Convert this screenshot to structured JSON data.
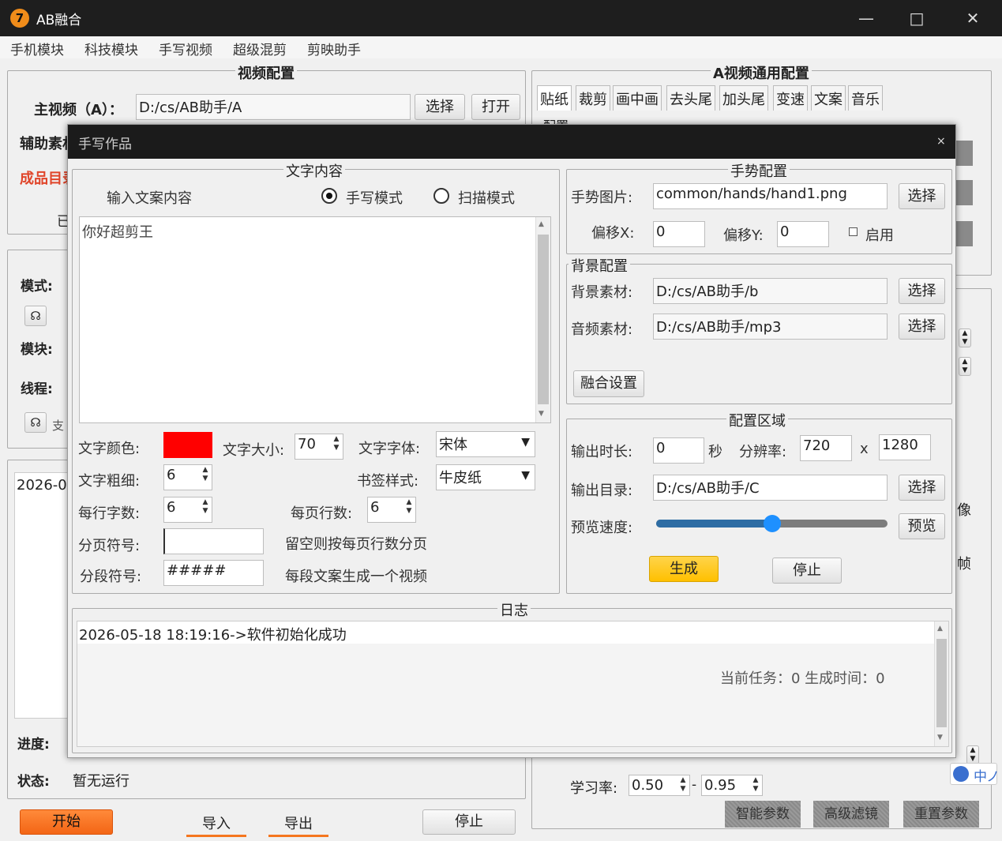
{
  "window": {
    "title": "AB融合",
    "app_icon_text": "7"
  },
  "menu": [
    "手机模块",
    "科技模块",
    "手写视频",
    "超级混剪",
    "剪映助手"
  ],
  "video_config": {
    "title": "视频配置",
    "main_video_label": "主视频（A）：",
    "main_video_path": "D:/cs/AB助手/A",
    "select_label": "选择",
    "open_label": "打开",
    "aux_label": "辅助素材",
    "output_label": "成品目录",
    "partial_text": "已"
  },
  "left_panel": {
    "mode_label": "模式:",
    "module_label": "模块:",
    "thread_label": "线程:",
    "partial_support": "支",
    "log_partial": "2026-05",
    "progress_label": "进度:",
    "status_label": "状态:",
    "status_value": "暂无运行",
    "start_label": "开始",
    "import_label": "导入",
    "export_label": "导出",
    "stop_label": "停止"
  },
  "a_config": {
    "title": "A视频通用配置",
    "tabs": [
      "贴纸",
      "裁剪",
      "画中画",
      "去头尾",
      "加头尾",
      "变速",
      "文案",
      "音乐"
    ],
    "partial_config": "配置",
    "partial_image": "像",
    "partial_frame": "帧",
    "lr_label": "学习率:",
    "lr_value1": "0.50",
    "lr_value2": "0.95",
    "lr_dash": "-",
    "btn_smart": "智能参数",
    "btn_advanced": "高级滤镜",
    "btn_reset": "重置参数",
    "partial_cn": "中",
    "partial_cn2": "ノ"
  },
  "dialog": {
    "title": "手写作品",
    "close": "×",
    "text_content": {
      "title": "文字内容",
      "prompt_label": "输入文案内容",
      "radio_handwrite": "手写模式",
      "radio_scan": "扫描模式",
      "text_value": "你好超剪王",
      "color_label": "文字颜色:",
      "text_color": "#ff0000",
      "size_label": "文字大小:",
      "size_value": "70",
      "font_label": "文字字体:",
      "font_value": "宋体",
      "weight_label": "文字粗细:",
      "weight_value": "6",
      "bookmark_label": "书签样式:",
      "bookmark_value": "牛皮纸",
      "chars_label": "每行字数:",
      "chars_value": "6",
      "lines_label": "每页行数:",
      "lines_value": "6",
      "page_sep_label": "分页符号:",
      "page_sep_value": "",
      "page_sep_hint": "留空则按每页行数分页",
      "para_sep_label": "分段符号:",
      "para_sep_value": "#####",
      "para_sep_hint": "每段文案生成一个视频"
    },
    "gesture": {
      "title": "手势配置",
      "image_label": "手势图片:",
      "image_value": "common/hands/hand1.png",
      "select_label": "选择",
      "offset_x_label": "偏移X:",
      "offset_x_value": "0",
      "offset_y_label": "偏移Y:",
      "offset_y_value": "0",
      "enable_label": "启用"
    },
    "background": {
      "title": "背景配置",
      "bg_label": "背景素材:",
      "bg_value": "D:/cs/AB助手/b",
      "audio_label": "音频素材:",
      "audio_value": "D:/cs/AB助手/mp3",
      "select_label": "选择",
      "merge_settings": "融合设置"
    },
    "config_area": {
      "title": "配置区域",
      "duration_label": "输出时长:",
      "duration_value": "0",
      "seconds": "秒",
      "resolution_label": "分辨率:",
      "res_w": "720",
      "res_x": "x",
      "res_h": "1280",
      "output_label": "输出目录:",
      "output_value": "D:/cs/AB助手/C",
      "select_label": "选择",
      "speed_label": "预览速度:",
      "speed_level": 0.5,
      "preview_label": "预览",
      "generate_label": "生成",
      "stop_label": "停止"
    },
    "log": {
      "title": "日志",
      "line1": "2026-05-18 18:19:16->软件初始化成功",
      "task_status": "当前任务：0 生成时间：0"
    }
  },
  "colors": {
    "accent_orange": "#f5761f",
    "generate_yellow": "#ffc400",
    "slider_blue": "#2e6da4",
    "slider_knob": "#1e90ff",
    "warn_red": "#e0452a"
  }
}
